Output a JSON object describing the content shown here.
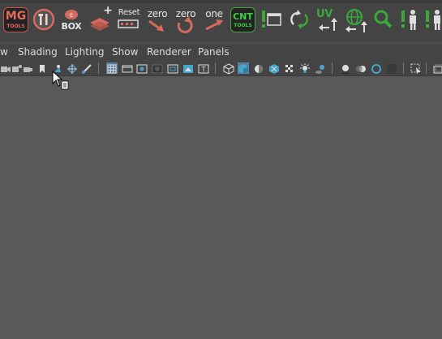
{
  "shelf": {
    "items": [
      {
        "id": "mg-tools",
        "line1": "MG",
        "line2": "TOOLS"
      },
      {
        "id": "tools",
        "label": ""
      },
      {
        "id": "box",
        "label": "BOX"
      },
      {
        "id": "layers-add",
        "label": "+"
      },
      {
        "id": "reset",
        "label": "Reset"
      },
      {
        "id": "zero-1",
        "label": "zero"
      },
      {
        "id": "zero-2",
        "label": "zero"
      },
      {
        "id": "one",
        "label": "one"
      },
      {
        "id": "cnt-tools",
        "line1": "CNT",
        "line2": "TOOLS"
      },
      {
        "id": "window",
        "label": ""
      },
      {
        "id": "refresh",
        "label": ""
      },
      {
        "id": "uv",
        "label": "UV"
      },
      {
        "id": "globe",
        "label": ""
      },
      {
        "id": "search",
        "label": ""
      },
      {
        "id": "figure-1",
        "label": ""
      },
      {
        "id": "figure-2",
        "label": ""
      }
    ]
  },
  "menubar": {
    "items": [
      "w",
      "Shading",
      "Lighting",
      "Show",
      "Renderer",
      "Panels"
    ]
  },
  "colors": {
    "shelf_bg": "#444444",
    "viewport_bg": "#595959",
    "accent_red": "#c9544b",
    "accent_green": "#3aa83a",
    "accent_blue": "#4aa3c8"
  }
}
